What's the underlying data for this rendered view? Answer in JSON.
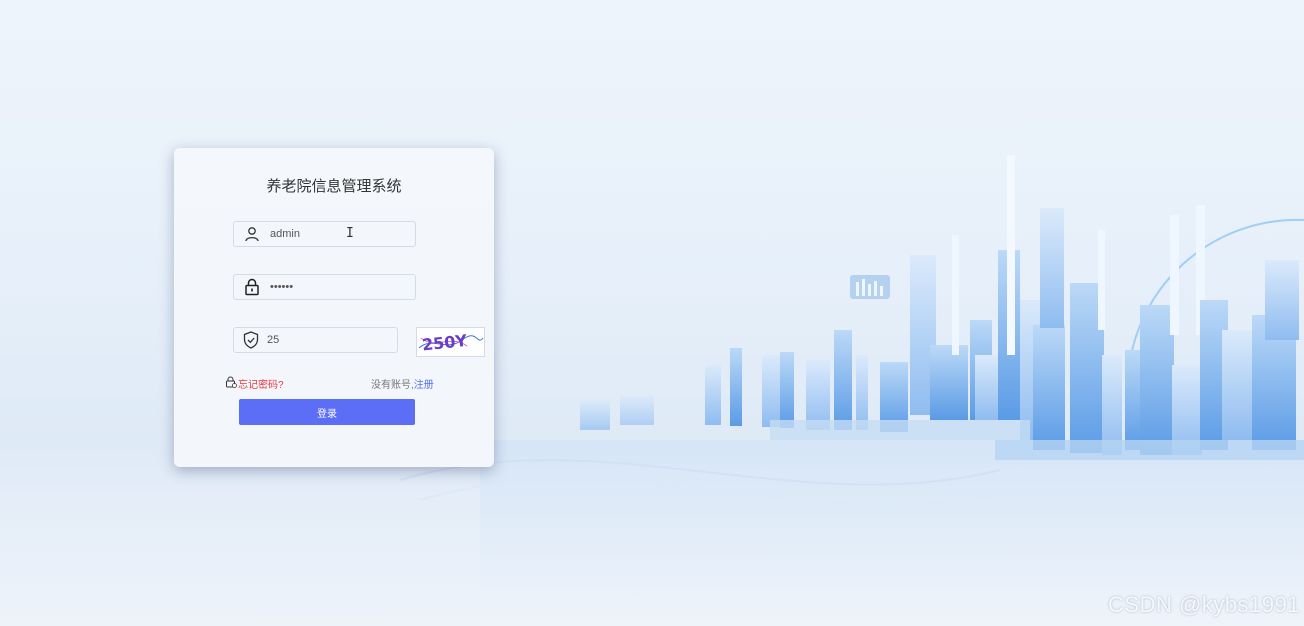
{
  "login": {
    "title": "养老院信息管理系统",
    "username_value": "admin",
    "password_value": "••••••",
    "captcha_input_value": "25",
    "captcha_image_text": "250Y",
    "forgot_label": "忘记密码?",
    "no_account_label": "没有账号,",
    "register_label": "注册",
    "login_button_label": "登录"
  },
  "watermark": "CSDN @kybs1991",
  "colors": {
    "primary": "#5b6ef5",
    "forgot": "#e4393c",
    "register": "#4f6ef2"
  },
  "icons": [
    "user-icon",
    "lock-icon",
    "shield-check-icon",
    "lock-small-icon"
  ]
}
